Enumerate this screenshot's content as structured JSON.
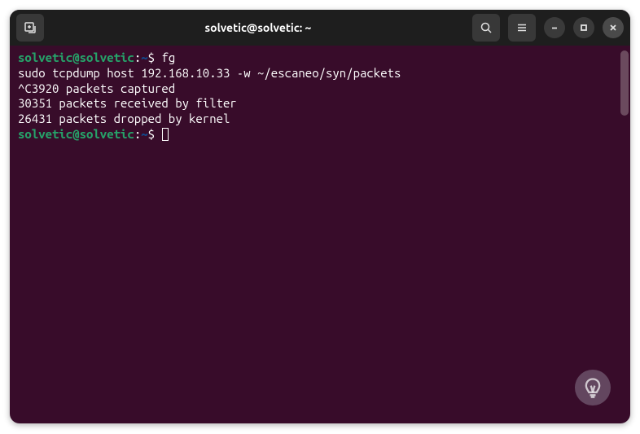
{
  "window": {
    "title": "solvetic@solvetic: ~"
  },
  "prompt": {
    "user_host": "solvetic@solvetic",
    "colon": ":",
    "path": "~",
    "sign": "$ "
  },
  "lines": {
    "cmd1": "fg",
    "out1": "sudo tcpdump host 192.168.10.33 -w ~/escaneo/syn/packets",
    "out2": "^C3920 packets captured",
    "out3": "30351 packets received by filter",
    "out4": "26431 packets dropped by kernel"
  }
}
